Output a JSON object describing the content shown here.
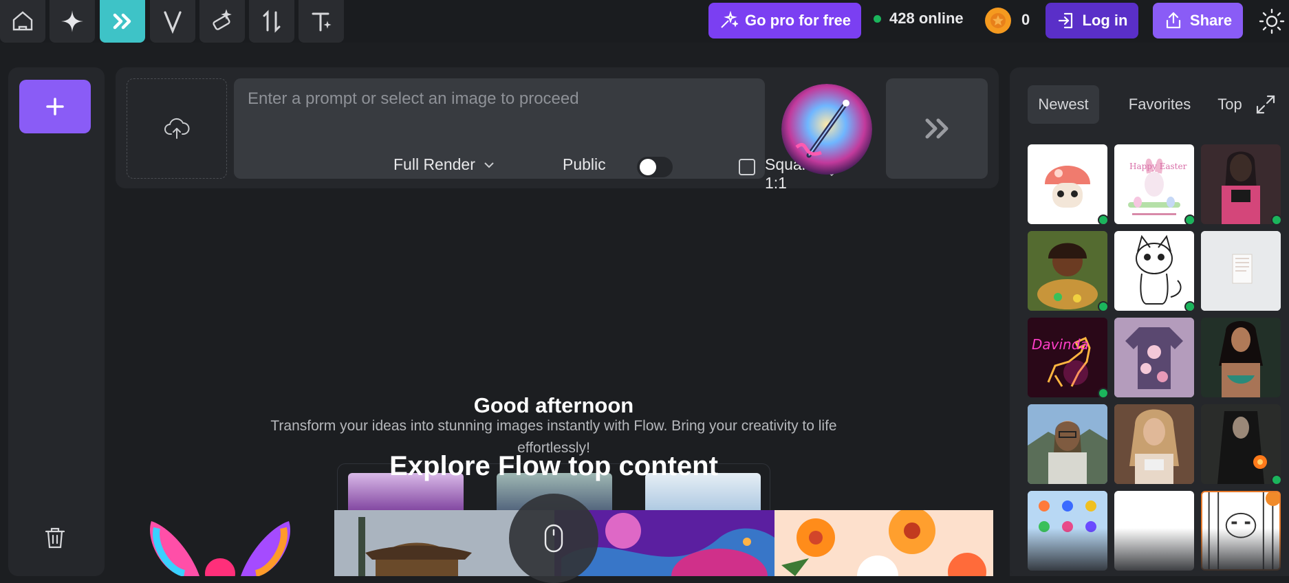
{
  "toolbar": {
    "tools": [
      {
        "icon": "home-icon"
      },
      {
        "icon": "sparkle-icon"
      },
      {
        "icon": "fast-forward-icon",
        "active": true
      },
      {
        "icon": "letter-v-icon"
      },
      {
        "icon": "magic-eraser-icon"
      },
      {
        "icon": "sort-arrows-icon"
      },
      {
        "icon": "text-sparkle-icon"
      }
    ],
    "go_pro_label": "Go pro for free",
    "online_count": "428",
    "online_label": "online",
    "coins": "0",
    "login_label": "Log in",
    "share_label": "Share",
    "accent": "#7b3ff2"
  },
  "composer": {
    "prompt_placeholder": "Enter a prompt or select an image to proceed",
    "render_mode": "Full Render",
    "visibility_label": "Public",
    "aspect_label": "Square 1:1"
  },
  "main": {
    "greeting": "Good afternoon",
    "subtitle": "Transform your ideas into stunning images instantly with Flow. Bring your creativity to life effortlessly!",
    "explore_title": "Explore Flow top content"
  },
  "gallery": {
    "tabs": [
      "Newest",
      "Favorites",
      "Top"
    ],
    "selected_tab": "Newest",
    "thumb_texts": {
      "easter": "Happy Easter",
      "davinda": "Davinda"
    }
  }
}
